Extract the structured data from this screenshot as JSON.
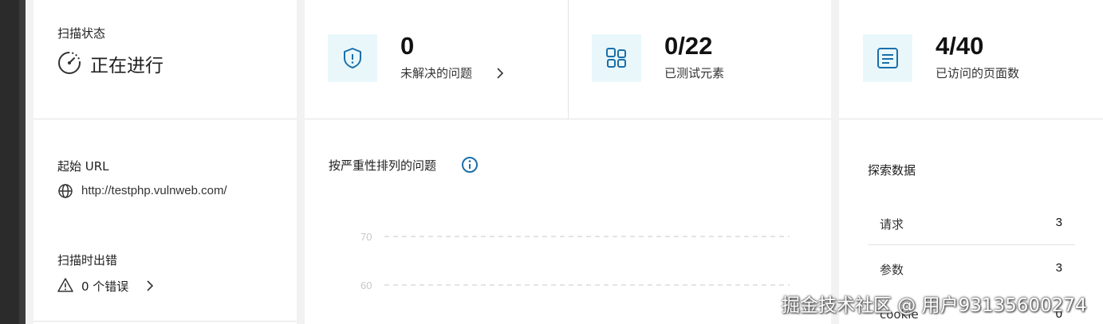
{
  "scan_status": {
    "title": "扫描状态",
    "value": "正在进行"
  },
  "metrics": [
    {
      "value": "0",
      "label": "未解决的问题",
      "icon": "shield-icon",
      "has_link": true
    },
    {
      "value": "0/22",
      "label": "已测试元素",
      "icon": "elements-grid-icon"
    },
    {
      "value": "4/40",
      "label": "已访问的页面数",
      "icon": "page-list-icon"
    }
  ],
  "start_url": {
    "title": "起始 URL",
    "value": "http://testphp.vulnweb.com/"
  },
  "scan_errors": {
    "title": "扫描时出错",
    "value": "0 个错误"
  },
  "severity_chart": {
    "title": "按严重性排列的问题"
  },
  "chart_data": {
    "type": "bar",
    "title": "按严重性排列的问题",
    "categories": [],
    "values": [],
    "y_ticks": [
      70,
      60
    ],
    "grid": true
  },
  "exploration": {
    "title": "探索数据",
    "rows": [
      {
        "label": "请求",
        "value": "3"
      },
      {
        "label": "参数",
        "value": "3"
      },
      {
        "label": "cookie",
        "value": "0"
      }
    ]
  },
  "watermark": "掘金技术社区 @ 用户93135600274",
  "colors": {
    "accent": "#1a6fa8",
    "icon_bg": "#e9f7fb",
    "background": "#f2f2f2"
  }
}
